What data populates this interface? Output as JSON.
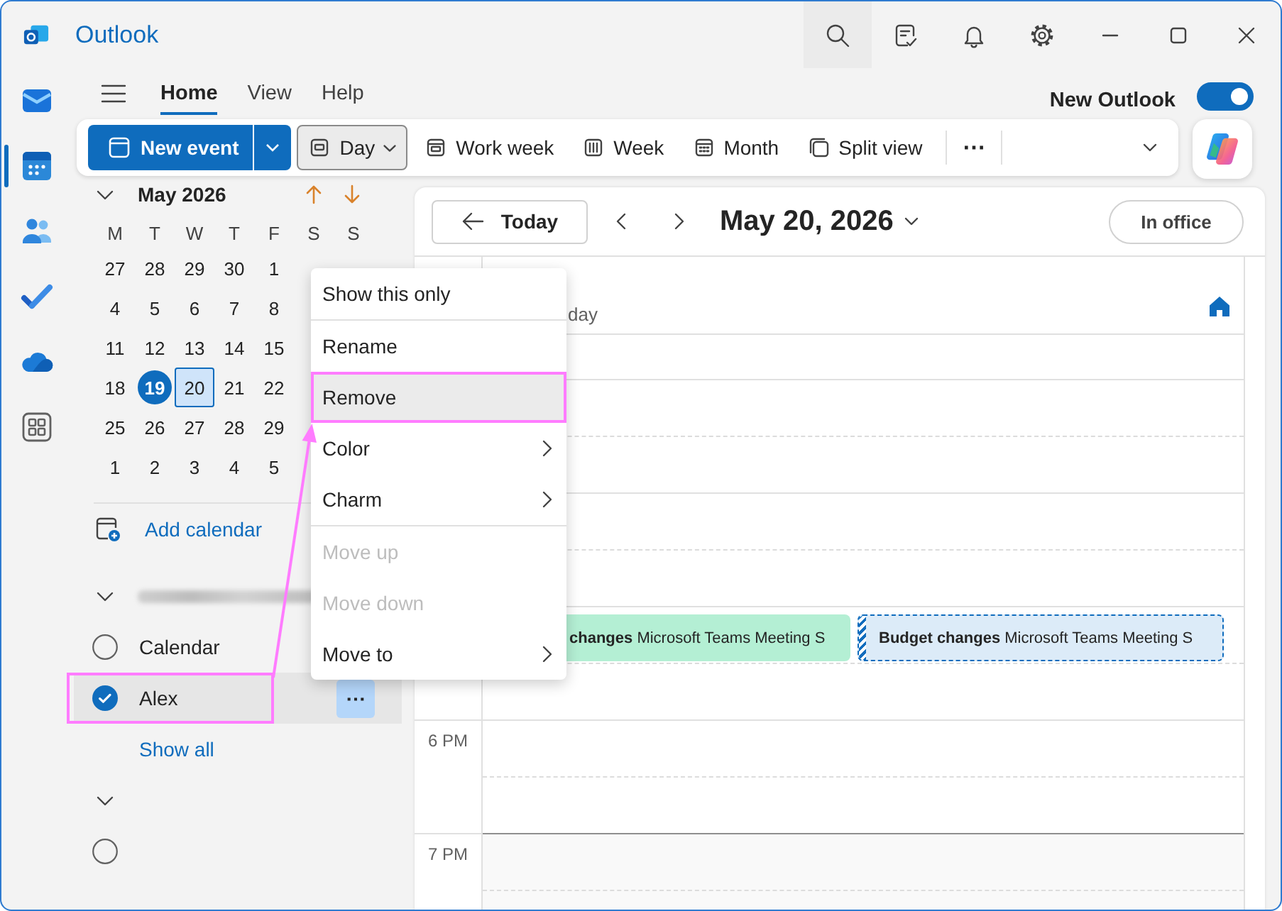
{
  "window": {
    "title": "Outlook"
  },
  "app_rail": [
    {
      "kind": "mail",
      "selected": false
    },
    {
      "kind": "calendar",
      "selected": true
    },
    {
      "kind": "people",
      "selected": false
    },
    {
      "kind": "todo",
      "selected": false
    },
    {
      "kind": "cloud",
      "selected": false
    },
    {
      "kind": "apps",
      "selected": false
    }
  ],
  "ribbon_tabs": [
    {
      "label": "Home",
      "selected": true
    },
    {
      "label": "View",
      "selected": false
    },
    {
      "label": "Help",
      "selected": false
    }
  ],
  "new_outlook": {
    "label": "New Outlook",
    "on": true
  },
  "toolbar": {
    "new_event": "New event",
    "views": [
      {
        "kind": "day",
        "label": "Day",
        "selected": true
      },
      {
        "kind": "work_week",
        "label": "Work week",
        "selected": false
      },
      {
        "kind": "week",
        "label": "Week",
        "selected": false
      },
      {
        "kind": "month",
        "label": "Month",
        "selected": false
      },
      {
        "kind": "split",
        "label": "Split view",
        "selected": false
      }
    ],
    "more": "⋯"
  },
  "mini_calendar": {
    "title": "May 2026",
    "expanded": true,
    "weekdays": [
      "M",
      "T",
      "W",
      "T",
      "F",
      "S",
      "S"
    ],
    "weeks": [
      [
        {
          "label": "27",
          "today": false,
          "selected": false
        },
        {
          "label": "28",
          "today": false,
          "selected": false
        },
        {
          "label": "29",
          "today": false,
          "selected": false
        },
        {
          "label": "30",
          "today": false,
          "selected": false
        },
        {
          "label": "1",
          "today": false,
          "selected": false
        }
      ],
      [
        {
          "label": "4",
          "today": false,
          "selected": false
        },
        {
          "label": "5",
          "today": false,
          "selected": false
        },
        {
          "label": "6",
          "today": false,
          "selected": false
        },
        {
          "label": "7",
          "today": false,
          "selected": false
        },
        {
          "label": "8",
          "today": false,
          "selected": false
        }
      ],
      [
        {
          "label": "11",
          "today": false,
          "selected": false
        },
        {
          "label": "12",
          "today": false,
          "selected": false
        },
        {
          "label": "13",
          "today": false,
          "selected": false
        },
        {
          "label": "14",
          "today": false,
          "selected": false
        },
        {
          "label": "15",
          "today": false,
          "selected": false
        }
      ],
      [
        {
          "label": "18",
          "today": false,
          "selected": false
        },
        {
          "label": "19",
          "today": true,
          "selected": false
        },
        {
          "label": "20",
          "today": false,
          "selected": true
        },
        {
          "label": "21",
          "today": false,
          "selected": false
        },
        {
          "label": "22",
          "today": false,
          "selected": false
        }
      ],
      [
        {
          "label": "25",
          "today": false,
          "selected": false
        },
        {
          "label": "26",
          "today": false,
          "selected": false
        },
        {
          "label": "27",
          "today": false,
          "selected": false
        },
        {
          "label": "28",
          "today": false,
          "selected": false
        },
        {
          "label": "29",
          "today": false,
          "selected": false
        }
      ],
      [
        {
          "label": "1",
          "today": false,
          "selected": false
        },
        {
          "label": "2",
          "today": false,
          "selected": false
        },
        {
          "label": "3",
          "today": false,
          "selected": false
        },
        {
          "label": "4",
          "today": false,
          "selected": false
        },
        {
          "label": "5",
          "today": false,
          "selected": false
        }
      ]
    ]
  },
  "add_calendar": "Add calendar",
  "calendar_groups": [
    {
      "expanded": true,
      "name_blurred": true,
      "calendars": [
        {
          "name": "Calendar",
          "checked": false,
          "selected": false,
          "marked": false
        },
        {
          "name": "Alex",
          "checked": true,
          "selected": true,
          "marked": true,
          "more": "⋯"
        }
      ],
      "show_all": "Show all"
    },
    {
      "expanded": true,
      "name_blurred": false,
      "calendars": [
        {
          "checked": false,
          "selected": false,
          "marked": false
        }
      ]
    }
  ],
  "calendar_view": {
    "today_button": "Today",
    "date_title": "May 20, 2026",
    "work_location": "In office",
    "day_header": "day",
    "hour_rows": [
      {
        "after_hours": false
      },
      {
        "after_hours": false
      },
      {
        "after_hours": false
      },
      {
        "after_hours": false,
        "events": [
          {
            "text": "**changes** Microsoft Teams Meeting S",
            "color": "#b4efd4",
            "tentative": false
          },
          {
            "text": "**Budget changes** Microsoft Teams Meeting S",
            "color": "#dcebf8",
            "tentative": true
          }
        ]
      },
      {
        "label": "6 PM",
        "after_hours": false
      },
      {
        "label": "7 PM",
        "after_hours": true
      }
    ]
  },
  "context_menu": {
    "sections": [
      [
        {
          "label": "Show this only",
          "submenu": false,
          "disabled": false,
          "selected": false,
          "marked": false
        }
      ],
      [
        {
          "label": "Rename",
          "submenu": false,
          "disabled": false,
          "selected": false,
          "marked": false
        },
        {
          "label": "Remove",
          "submenu": false,
          "disabled": false,
          "selected": true,
          "marked": true
        },
        {
          "label": "Color",
          "submenu": true,
          "disabled": false,
          "selected": false,
          "marked": false
        },
        {
          "label": "Charm",
          "submenu": true,
          "disabled": false,
          "selected": false,
          "marked": false
        }
      ],
      [
        {
          "label": "Move up",
          "submenu": false,
          "disabled": true,
          "selected": false,
          "marked": false
        },
        {
          "label": "Move down",
          "submenu": false,
          "disabled": true,
          "selected": false,
          "marked": false
        },
        {
          "label": "Move to",
          "submenu": true,
          "disabled": false,
          "selected": false,
          "marked": false
        }
      ]
    ]
  }
}
